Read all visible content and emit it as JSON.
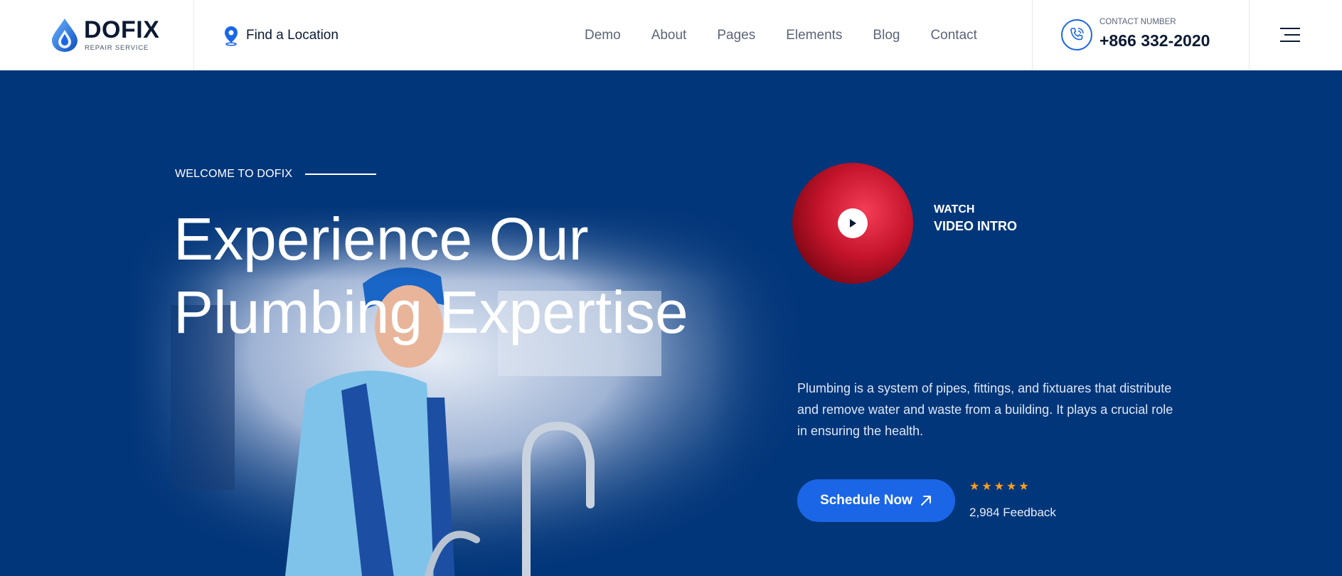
{
  "header": {
    "logo": {
      "name": "DOFIX",
      "tagline": "REPAIR SERVICE"
    },
    "location_link": {
      "icon": "map-pin-icon",
      "label": "Find a Location"
    },
    "nav": [
      "Demo",
      "About",
      "Pages",
      "Elements",
      "Blog",
      "Contact"
    ],
    "contact": {
      "icon": "phone-call-icon",
      "label": "CONTACT NUMBER",
      "number": "+866 332-2020"
    },
    "menu_icon": "hamburger-menu-icon"
  },
  "hero": {
    "eyebrow": "WELCOME TO DOFIX",
    "headline_line1": "Experience Our",
    "headline_line2": "Plumbing Expertise",
    "video": {
      "icon": "play-icon",
      "label_line1": "WATCH",
      "label_line2": "VIDEO INTRO"
    },
    "description": "Plumbing is a system of pipes, fittings, and fixtuares that distribute and remove water and waste from a building. It plays a crucial role in ensuring the health.",
    "cta": {
      "label": "Schedule Now",
      "icon": "arrow-up-right-icon"
    },
    "rating": {
      "stars": 5,
      "feedback": "2,984 Feedback"
    }
  },
  "colors": {
    "brand_blue": "#1a66e6",
    "hero_bg": "#02367a",
    "dark_text": "#0c1a33",
    "star": "#ff9f1c",
    "video_red": "#d81b35"
  }
}
